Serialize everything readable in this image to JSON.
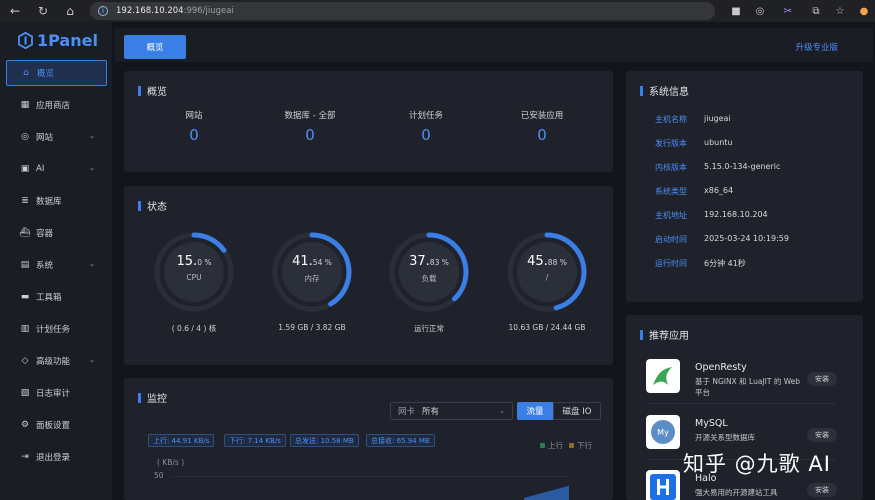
{
  "browser": {
    "url_host": "192.168.10.204",
    "url_rest": ":996/jiugeai"
  },
  "brand": {
    "name": "1Panel",
    "color": "#4d8ff7"
  },
  "sidebar": {
    "items": [
      {
        "label": "概览",
        "icon": "home-icon",
        "active": true
      },
      {
        "label": "应用商店",
        "icon": "grid-icon"
      },
      {
        "label": "网站",
        "icon": "globe-icon",
        "expandable": true
      },
      {
        "label": "AI",
        "icon": "robot-icon",
        "expandable": true
      },
      {
        "label": "数据库",
        "icon": "database-icon"
      },
      {
        "label": "容器",
        "icon": "container-icon"
      },
      {
        "label": "系统",
        "icon": "system-icon",
        "expandable": true
      },
      {
        "label": "工具箱",
        "icon": "toolbox-icon"
      },
      {
        "label": "计划任务",
        "icon": "task-icon"
      },
      {
        "label": "高级功能",
        "icon": "diamond-icon",
        "expandable": true
      },
      {
        "label": "日志审计",
        "icon": "log-icon"
      },
      {
        "label": "面板设置",
        "icon": "gear-icon"
      },
      {
        "label": "退出登录",
        "icon": "logout-icon"
      }
    ]
  },
  "topbar": {
    "tab": "概览",
    "upgrade": "升级专业版"
  },
  "overview": {
    "title": "概览",
    "stats": [
      {
        "label": "网站",
        "value": "0"
      },
      {
        "label": "数据库 - 全部",
        "value": "0"
      },
      {
        "label": "计划任务",
        "value": "0"
      },
      {
        "label": "已安装应用",
        "value": "0"
      }
    ]
  },
  "status": {
    "title": "状态",
    "gauges": [
      {
        "int": "15.",
        "dec": "0",
        "unit": "%",
        "label": "CPU",
        "foot": "( 0.6 / 4 ) 核",
        "percent": 15.0
      },
      {
        "int": "41.",
        "dec": "54",
        "unit": "%",
        "label": "内存",
        "foot": "1.59 GB / 3.82 GB",
        "percent": 41.54
      },
      {
        "int": "37.",
        "dec": "83",
        "unit": "%",
        "label": "负载",
        "foot": "运行正常",
        "percent": 37.83
      },
      {
        "int": "45.",
        "dec": "88",
        "unit": "%",
        "label": "/",
        "foot": "10.63 GB / 24.44 GB",
        "percent": 45.88
      }
    ]
  },
  "sysinfo": {
    "title": "系统信息",
    "rows": [
      {
        "k": "主机名称",
        "v": "jiugeai"
      },
      {
        "k": "发行版本",
        "v": "ubuntu"
      },
      {
        "k": "内核版本",
        "v": "5.15.0-134-generic"
      },
      {
        "k": "系统类型",
        "v": "x86_64"
      },
      {
        "k": "主机地址",
        "v": "192.168.10.204"
      },
      {
        "k": "启动时间",
        "v": "2025-03-24 10:19:59"
      },
      {
        "k": "运行时间",
        "v": "6分钟 41秒"
      }
    ]
  },
  "apps": {
    "title": "推荐应用",
    "install_label": "安装",
    "items": [
      {
        "name": "OpenResty",
        "desc": "基于 NGINX 和 LuaJIT 的 Web 平台"
      },
      {
        "name": "MySQL",
        "desc": "开源关系型数据库"
      },
      {
        "name": "Halo",
        "desc": "强大易用的开源建站工具"
      }
    ]
  },
  "monitor": {
    "title": "监控",
    "nic_label": "网卡",
    "nic_value": "所有",
    "seg_traffic": "流量",
    "seg_disk": "磁盘 IO",
    "chips": [
      "上行: 44.91 KB/s",
      "下行: 7.14 KB/s",
      "总发送: 10.58 MB",
      "总接收: 65.94 MB"
    ],
    "legend_up": "上行",
    "legend_down": "下行",
    "y_unit": "( KB/s )",
    "y_tick": "50"
  },
  "watermark": "知乎 @九歌 AI",
  "colors": {
    "accent": "#3a7ee6",
    "panel": "#1f222b",
    "background": "#13151c"
  }
}
